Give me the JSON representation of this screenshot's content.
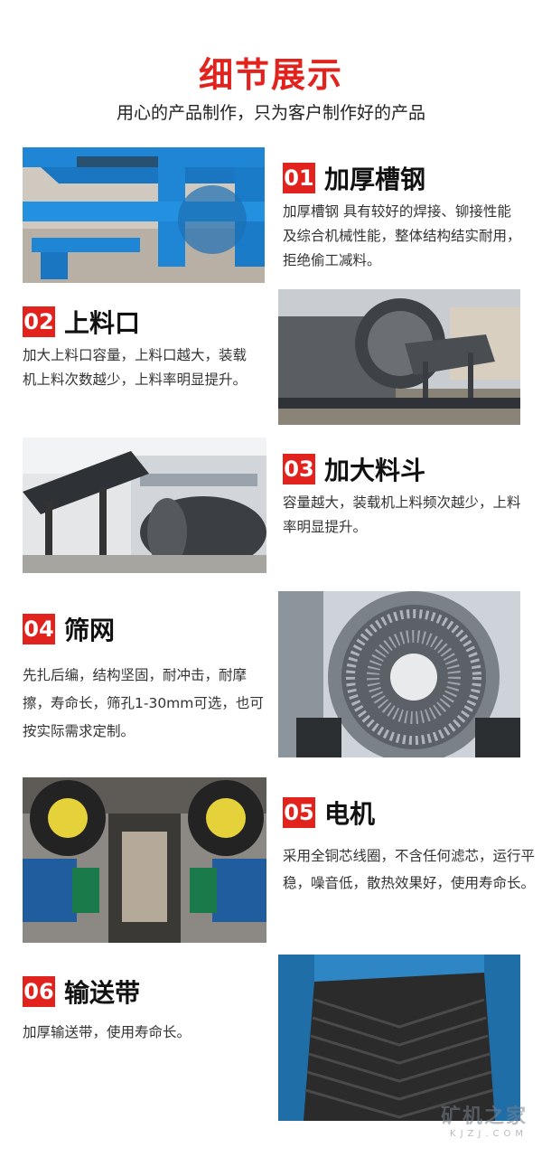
{
  "header": {
    "title": "细节展示",
    "subtitle": "用心的产品制作，只为客户制作好的产品"
  },
  "items": [
    {
      "num": "01",
      "title": "加厚槽钢",
      "desc": "加厚槽钢 具有较好的焊接、铆接性能及综合机械性能，整体结构结实耐用，拒绝偷工减料。",
      "image": "blue-steel-frame-photo"
    },
    {
      "num": "02",
      "title": "上料口",
      "desc": "加大上料口容量，上料口越大，装载机上料次数越少，上料率明显提升。",
      "image": "feed-inlet-photo"
    },
    {
      "num": "03",
      "title": "加大料斗",
      "desc": "容量越大，装载机上料频次越少，上料率明显提升。",
      "image": "hopper-photo"
    },
    {
      "num": "04",
      "title": "筛网",
      "desc": "先扎后编，结构坚固，耐冲击，耐摩擦，寿命长，筛孔1-30mm可选，也可按实际需求定制。",
      "image": "screen-drum-photo"
    },
    {
      "num": "05",
      "title": "电机",
      "desc": "采用全铜芯线圈，不含任何滤芯，运行平稳，噪音低，散热效果好，使用寿命长。",
      "image": "motor-photo"
    },
    {
      "num": "06",
      "title": "输送带",
      "desc": "加厚输送带，使用寿命长。",
      "image": "conveyor-belt-photo"
    }
  ],
  "watermark": {
    "line1": "矿机之家",
    "line2": "KJZJ.COM"
  },
  "colors": {
    "accent": "#e2221d"
  }
}
